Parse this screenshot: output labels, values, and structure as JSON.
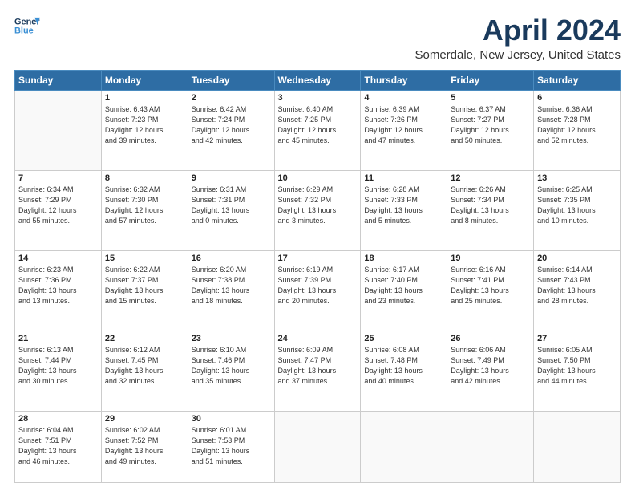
{
  "header": {
    "logo_line1": "General",
    "logo_line2": "Blue",
    "month": "April 2024",
    "location": "Somerdale, New Jersey, United States"
  },
  "weekdays": [
    "Sunday",
    "Monday",
    "Tuesday",
    "Wednesday",
    "Thursday",
    "Friday",
    "Saturday"
  ],
  "weeks": [
    [
      {
        "day": "",
        "info": ""
      },
      {
        "day": "1",
        "info": "Sunrise: 6:43 AM\nSunset: 7:23 PM\nDaylight: 12 hours\nand 39 minutes."
      },
      {
        "day": "2",
        "info": "Sunrise: 6:42 AM\nSunset: 7:24 PM\nDaylight: 12 hours\nand 42 minutes."
      },
      {
        "day": "3",
        "info": "Sunrise: 6:40 AM\nSunset: 7:25 PM\nDaylight: 12 hours\nand 45 minutes."
      },
      {
        "day": "4",
        "info": "Sunrise: 6:39 AM\nSunset: 7:26 PM\nDaylight: 12 hours\nand 47 minutes."
      },
      {
        "day": "5",
        "info": "Sunrise: 6:37 AM\nSunset: 7:27 PM\nDaylight: 12 hours\nand 50 minutes."
      },
      {
        "day": "6",
        "info": "Sunrise: 6:36 AM\nSunset: 7:28 PM\nDaylight: 12 hours\nand 52 minutes."
      }
    ],
    [
      {
        "day": "7",
        "info": "Sunrise: 6:34 AM\nSunset: 7:29 PM\nDaylight: 12 hours\nand 55 minutes."
      },
      {
        "day": "8",
        "info": "Sunrise: 6:32 AM\nSunset: 7:30 PM\nDaylight: 12 hours\nand 57 minutes."
      },
      {
        "day": "9",
        "info": "Sunrise: 6:31 AM\nSunset: 7:31 PM\nDaylight: 13 hours\nand 0 minutes."
      },
      {
        "day": "10",
        "info": "Sunrise: 6:29 AM\nSunset: 7:32 PM\nDaylight: 13 hours\nand 3 minutes."
      },
      {
        "day": "11",
        "info": "Sunrise: 6:28 AM\nSunset: 7:33 PM\nDaylight: 13 hours\nand 5 minutes."
      },
      {
        "day": "12",
        "info": "Sunrise: 6:26 AM\nSunset: 7:34 PM\nDaylight: 13 hours\nand 8 minutes."
      },
      {
        "day": "13",
        "info": "Sunrise: 6:25 AM\nSunset: 7:35 PM\nDaylight: 13 hours\nand 10 minutes."
      }
    ],
    [
      {
        "day": "14",
        "info": "Sunrise: 6:23 AM\nSunset: 7:36 PM\nDaylight: 13 hours\nand 13 minutes."
      },
      {
        "day": "15",
        "info": "Sunrise: 6:22 AM\nSunset: 7:37 PM\nDaylight: 13 hours\nand 15 minutes."
      },
      {
        "day": "16",
        "info": "Sunrise: 6:20 AM\nSunset: 7:38 PM\nDaylight: 13 hours\nand 18 minutes."
      },
      {
        "day": "17",
        "info": "Sunrise: 6:19 AM\nSunset: 7:39 PM\nDaylight: 13 hours\nand 20 minutes."
      },
      {
        "day": "18",
        "info": "Sunrise: 6:17 AM\nSunset: 7:40 PM\nDaylight: 13 hours\nand 23 minutes."
      },
      {
        "day": "19",
        "info": "Sunrise: 6:16 AM\nSunset: 7:41 PM\nDaylight: 13 hours\nand 25 minutes."
      },
      {
        "day": "20",
        "info": "Sunrise: 6:14 AM\nSunset: 7:43 PM\nDaylight: 13 hours\nand 28 minutes."
      }
    ],
    [
      {
        "day": "21",
        "info": "Sunrise: 6:13 AM\nSunset: 7:44 PM\nDaylight: 13 hours\nand 30 minutes."
      },
      {
        "day": "22",
        "info": "Sunrise: 6:12 AM\nSunset: 7:45 PM\nDaylight: 13 hours\nand 32 minutes."
      },
      {
        "day": "23",
        "info": "Sunrise: 6:10 AM\nSunset: 7:46 PM\nDaylight: 13 hours\nand 35 minutes."
      },
      {
        "day": "24",
        "info": "Sunrise: 6:09 AM\nSunset: 7:47 PM\nDaylight: 13 hours\nand 37 minutes."
      },
      {
        "day": "25",
        "info": "Sunrise: 6:08 AM\nSunset: 7:48 PM\nDaylight: 13 hours\nand 40 minutes."
      },
      {
        "day": "26",
        "info": "Sunrise: 6:06 AM\nSunset: 7:49 PM\nDaylight: 13 hours\nand 42 minutes."
      },
      {
        "day": "27",
        "info": "Sunrise: 6:05 AM\nSunset: 7:50 PM\nDaylight: 13 hours\nand 44 minutes."
      }
    ],
    [
      {
        "day": "28",
        "info": "Sunrise: 6:04 AM\nSunset: 7:51 PM\nDaylight: 13 hours\nand 46 minutes."
      },
      {
        "day": "29",
        "info": "Sunrise: 6:02 AM\nSunset: 7:52 PM\nDaylight: 13 hours\nand 49 minutes."
      },
      {
        "day": "30",
        "info": "Sunrise: 6:01 AM\nSunset: 7:53 PM\nDaylight: 13 hours\nand 51 minutes."
      },
      {
        "day": "",
        "info": ""
      },
      {
        "day": "",
        "info": ""
      },
      {
        "day": "",
        "info": ""
      },
      {
        "day": "",
        "info": ""
      }
    ]
  ]
}
